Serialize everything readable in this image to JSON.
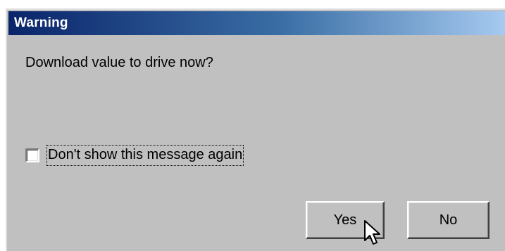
{
  "dialog": {
    "title": "Warning",
    "message": "Download value to drive now?",
    "checkbox": {
      "label": "Don't show this message again",
      "checked": false
    },
    "buttons": {
      "yes_label": "Yes",
      "no_label": "No"
    }
  },
  "icons": {
    "cursor": "mouse-pointer-icon"
  },
  "colors": {
    "titlebar_start": "#0a246a",
    "titlebar_end": "#a6caf0",
    "face": "#c0c0c0"
  }
}
